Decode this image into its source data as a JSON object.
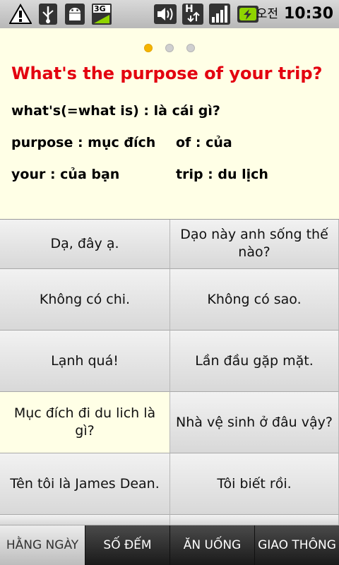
{
  "status_bar": {
    "ampm": "오전",
    "time": "10:30",
    "network_label": "3G",
    "data_label": "H"
  },
  "card": {
    "pager_dots": 3,
    "active_dot": 0,
    "sentence": "What's the purpose of your trip?",
    "vocab": [
      {
        "text": "what's(=what is) : là cái gì?"
      },
      {
        "text": "purpose : mục đích"
      },
      {
        "text": "of : của"
      },
      {
        "text": "your : của bạn"
      },
      {
        "text": "trip : du lịch"
      }
    ]
  },
  "phrases": [
    {
      "text": "Dạ, đây ạ.",
      "selected": false
    },
    {
      "text": "Dạo này anh sống thế nào?",
      "selected": false
    },
    {
      "text": "Không có chi.",
      "selected": false
    },
    {
      "text": "Không có sao.",
      "selected": false
    },
    {
      "text": "Lạnh quá!",
      "selected": false
    },
    {
      "text": "Lần đầu gặp mặt.",
      "selected": false
    },
    {
      "text": "Mục đích đi du lich là gì?",
      "selected": true
    },
    {
      "text": "Nhà vệ sinh ở đâu vậy?",
      "selected": false
    },
    {
      "text": "Tên tôi là James Dean.",
      "selected": false
    },
    {
      "text": "Tôi biết rồi.",
      "selected": false
    }
  ],
  "tabs": [
    {
      "label": "HẰNG NGÀY",
      "active": true
    },
    {
      "label": "SỐ ĐẾM",
      "active": false
    },
    {
      "label": "ĂN UỐNG",
      "active": false
    },
    {
      "label": "GIAO THÔNG",
      "active": false
    }
  ],
  "colors": {
    "sentence": "#e3000f",
    "card_bg": "#ffffe6",
    "dot_active": "#f5b400"
  }
}
